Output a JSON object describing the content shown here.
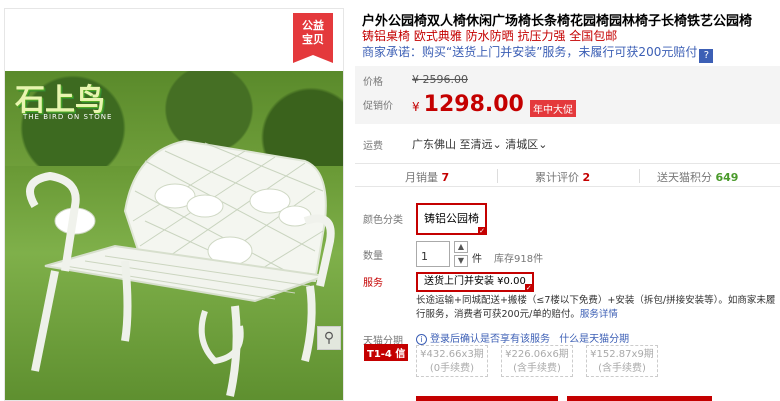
{
  "badge": {
    "line1": "公益",
    "line2": "宝贝"
  },
  "image": {
    "logo_text": "石上鸟",
    "logo_sub": "THE BIRD ON STONE",
    "zoom_icon": "magnifier-icon"
  },
  "product": {
    "title": "户外公园椅双人椅休闲广场椅长条椅花园椅园林椅子长椅铁艺公园椅",
    "subtitle": "铸铝桌椅 欧式典雅 防水防晒 抗压力强 全国包邮",
    "promise": "商家承诺：购买“送货上门并安装”服务，未履行可获200元赔付",
    "promise_help": "?"
  },
  "price": {
    "orig_label": "价格",
    "orig_value": "¥ 2596.00",
    "cur_label": "促销价",
    "cur_symbol": "¥",
    "cur_value": "1298.00",
    "promo_tag": "年中大促"
  },
  "shipping": {
    "label": "运费",
    "from": "广东佛山",
    "to_label": "至清远",
    "district": "清城区"
  },
  "stats": {
    "monthly_label": "月销量",
    "monthly_value": "7",
    "reviews_label": "累计评价",
    "reviews_value": "2",
    "points_label": "送天猫积分",
    "points_value": "649"
  },
  "options": {
    "color_label": "颜色分类",
    "color_value": "铸铝公园椅",
    "qty_label": "数量",
    "qty_value": "1",
    "qty_unit": "件",
    "stock": "库存918件",
    "service_label": "服务",
    "service_value": "送货上门并安装 ¥0.00",
    "service_note": "长途运输+同城配送+搬楼（≤7楼以下免费）+安装（拆包/拼接安装等）。如商家未履行服务，消费者可获200元/单的赔付。",
    "service_link": "服务详情"
  },
  "installment": {
    "label": "天猫分期",
    "tag": "T1-4 信",
    "login_text": "登录后确认是否享有该服务",
    "what_link": "什么是天猫分期",
    "plans": [
      {
        "line1": "¥432.66x3期",
        "line2": "(0手续费)"
      },
      {
        "line1": "¥226.06x6期",
        "line2": "(含手续费)"
      },
      {
        "line1": "¥152.87x9期",
        "line2": "(含手续费)"
      }
    ]
  },
  "colors": {
    "accent": "#c40000",
    "link": "#3c5fb5"
  }
}
